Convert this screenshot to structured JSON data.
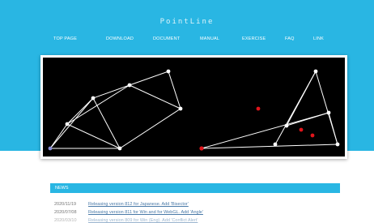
{
  "site": {
    "logo": "PointLine"
  },
  "nav": {
    "items": [
      "TOP PAGE",
      "DOWNLOAD",
      "DOCUMENT",
      "MANUAL",
      "EXERCISE",
      "FAQ",
      "LINK"
    ]
  },
  "news": {
    "title": "NEWS",
    "items": [
      {
        "date": "2020/11/19",
        "text": "Releasing version 812 for Japanese. Add 'Bisector'"
      },
      {
        "date": "2020/07/08",
        "text": "Releasing version 811 for Win and for WebGL. Add 'Angle'"
      },
      {
        "date": "2020/03/10",
        "text": "Releasing version 809 for Win (Eng). Add 'Conflict Alert'"
      }
    ]
  },
  "colors": {
    "brand": "#29b6e3",
    "canvas": "#000000",
    "link": "#4a7aa8",
    "point_red": "#e0151b",
    "point_white": "#ffffff"
  }
}
